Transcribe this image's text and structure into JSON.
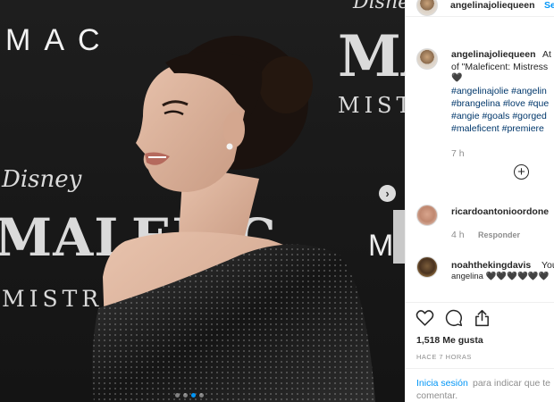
{
  "photo": {
    "backdrop": {
      "mac": "MAC",
      "disney_left": "Disney",
      "maleficent_left": "MALEFIC",
      "mistress_left": "MISTRESS",
      "disney_right": "Disney",
      "maleficent_right": "MA",
      "mistress_right": "MIST",
      "mac_right": "M"
    },
    "next_arrow": "›",
    "carousel": {
      "total": 4,
      "active": 3
    }
  },
  "header": {
    "username": "angelinajoliequeen",
    "follow_label": "Se"
  },
  "caption": {
    "username": "angelinajoliequeen",
    "text_line1": "At",
    "text_line2": "of \"Maleficent: Mistress",
    "heart": "🖤",
    "hashtags": [
      "#angelinajolie",
      "#angelin",
      "#brangelina",
      "#love",
      "#que",
      "#angie",
      "#goals",
      "#gorged",
      "#maleficent",
      "#premiere"
    ],
    "time": "7 h"
  },
  "comments": [
    {
      "username": "ricardoantonioordone",
      "time": "4 h",
      "reply_label": "Responder"
    },
    {
      "username": "noahthekingdavis",
      "text": "You",
      "text_line2": "angelina 🖤🖤🖤🖤🖤🖤"
    }
  ],
  "actions": {
    "likes": "1,518 Me gusta",
    "posted": "HACE 7 HORAS"
  },
  "login": {
    "link": "Inicia sesión",
    "rest": "para indicar que te",
    "line2": "comentar."
  },
  "colors": {
    "link": "#0095f6",
    "hashtag": "#00376b",
    "muted": "#8e8e8e",
    "text": "#262626"
  }
}
